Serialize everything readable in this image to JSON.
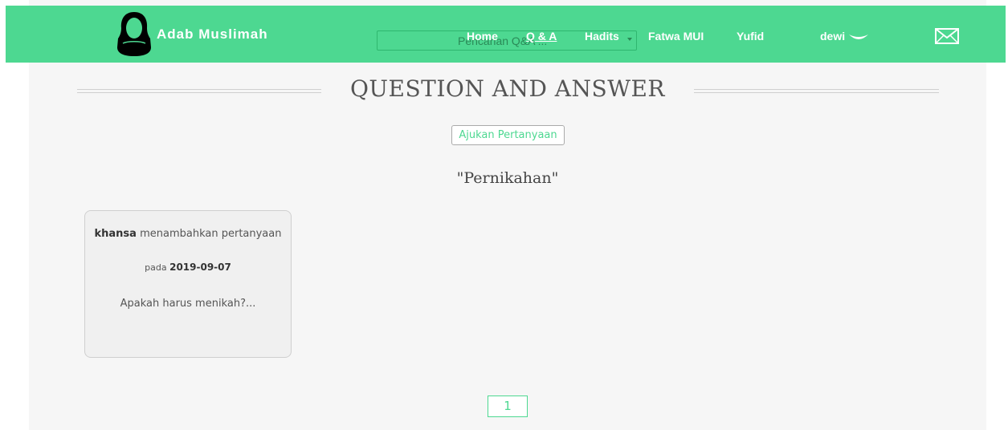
{
  "header": {
    "brand": "Adab Muslimah",
    "search_placeholder": "Pencarian Q&A ...",
    "nav": [
      {
        "label": "Home"
      },
      {
        "label": "Q & A"
      },
      {
        "label": "Hadits"
      },
      {
        "label": "Fatwa MUI"
      },
      {
        "label": "Yufid"
      }
    ],
    "user": "dewi",
    "icons": {
      "logo": "hijab-woman-icon",
      "user_menu": "chevron-down-icon",
      "messages": "mail-icon"
    }
  },
  "main": {
    "title": "QUESTION AND ANSWER",
    "ask_button": "Ajukan Pertanyaan",
    "category": "\"Pernikahan\"",
    "questions": [
      {
        "author": "khansa",
        "action": "menambahkan pertanyaan",
        "date_prefix": "pada",
        "date": "2019-09-07",
        "excerpt": "Apakah harus menikah?..."
      }
    ],
    "pagination": {
      "current": "1"
    }
  },
  "colors": {
    "accent": "#4dd891",
    "background": "#f6f6f6",
    "card": "#f0f0f0",
    "text": "#555555"
  }
}
